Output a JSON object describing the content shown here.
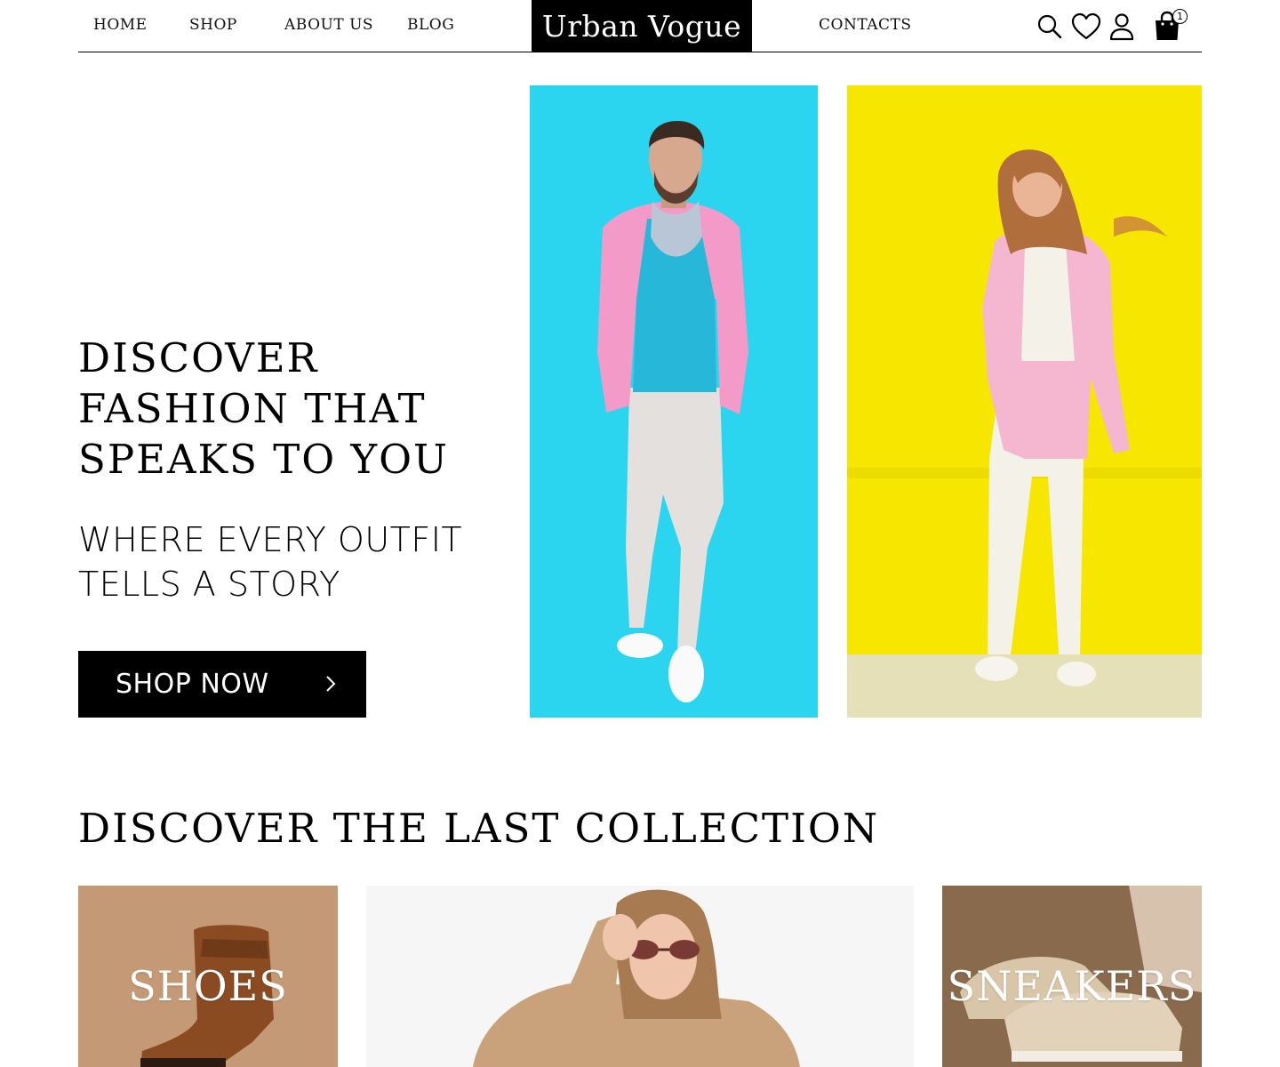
{
  "header": {
    "nav_left": [
      "HOME",
      "SHOP",
      "ABOUT US",
      "BLOG"
    ],
    "logo": "Urban Vogue",
    "nav_right": [
      "CONTACTS"
    ],
    "cart_count": "1",
    "icons": [
      "search-icon",
      "heart-icon",
      "user-icon",
      "shopping-bag-icon"
    ]
  },
  "hero": {
    "title": "DISCOVER FASHION THAT SPEAKS TO YOU",
    "subtitle": "WHERE EVERY OUTFIT TELLS A STORY",
    "cta_label": "SHOP NOW",
    "colors": {
      "photo1_bg": "#2bd4ef",
      "photo2_bg": "#f7e600",
      "blazer": "#f39ac8"
    }
  },
  "collection": {
    "title": "DISCOVER THE LAST COLLECTION",
    "tiles": [
      "SHOES",
      "",
      "SNEAKERS"
    ]
  }
}
